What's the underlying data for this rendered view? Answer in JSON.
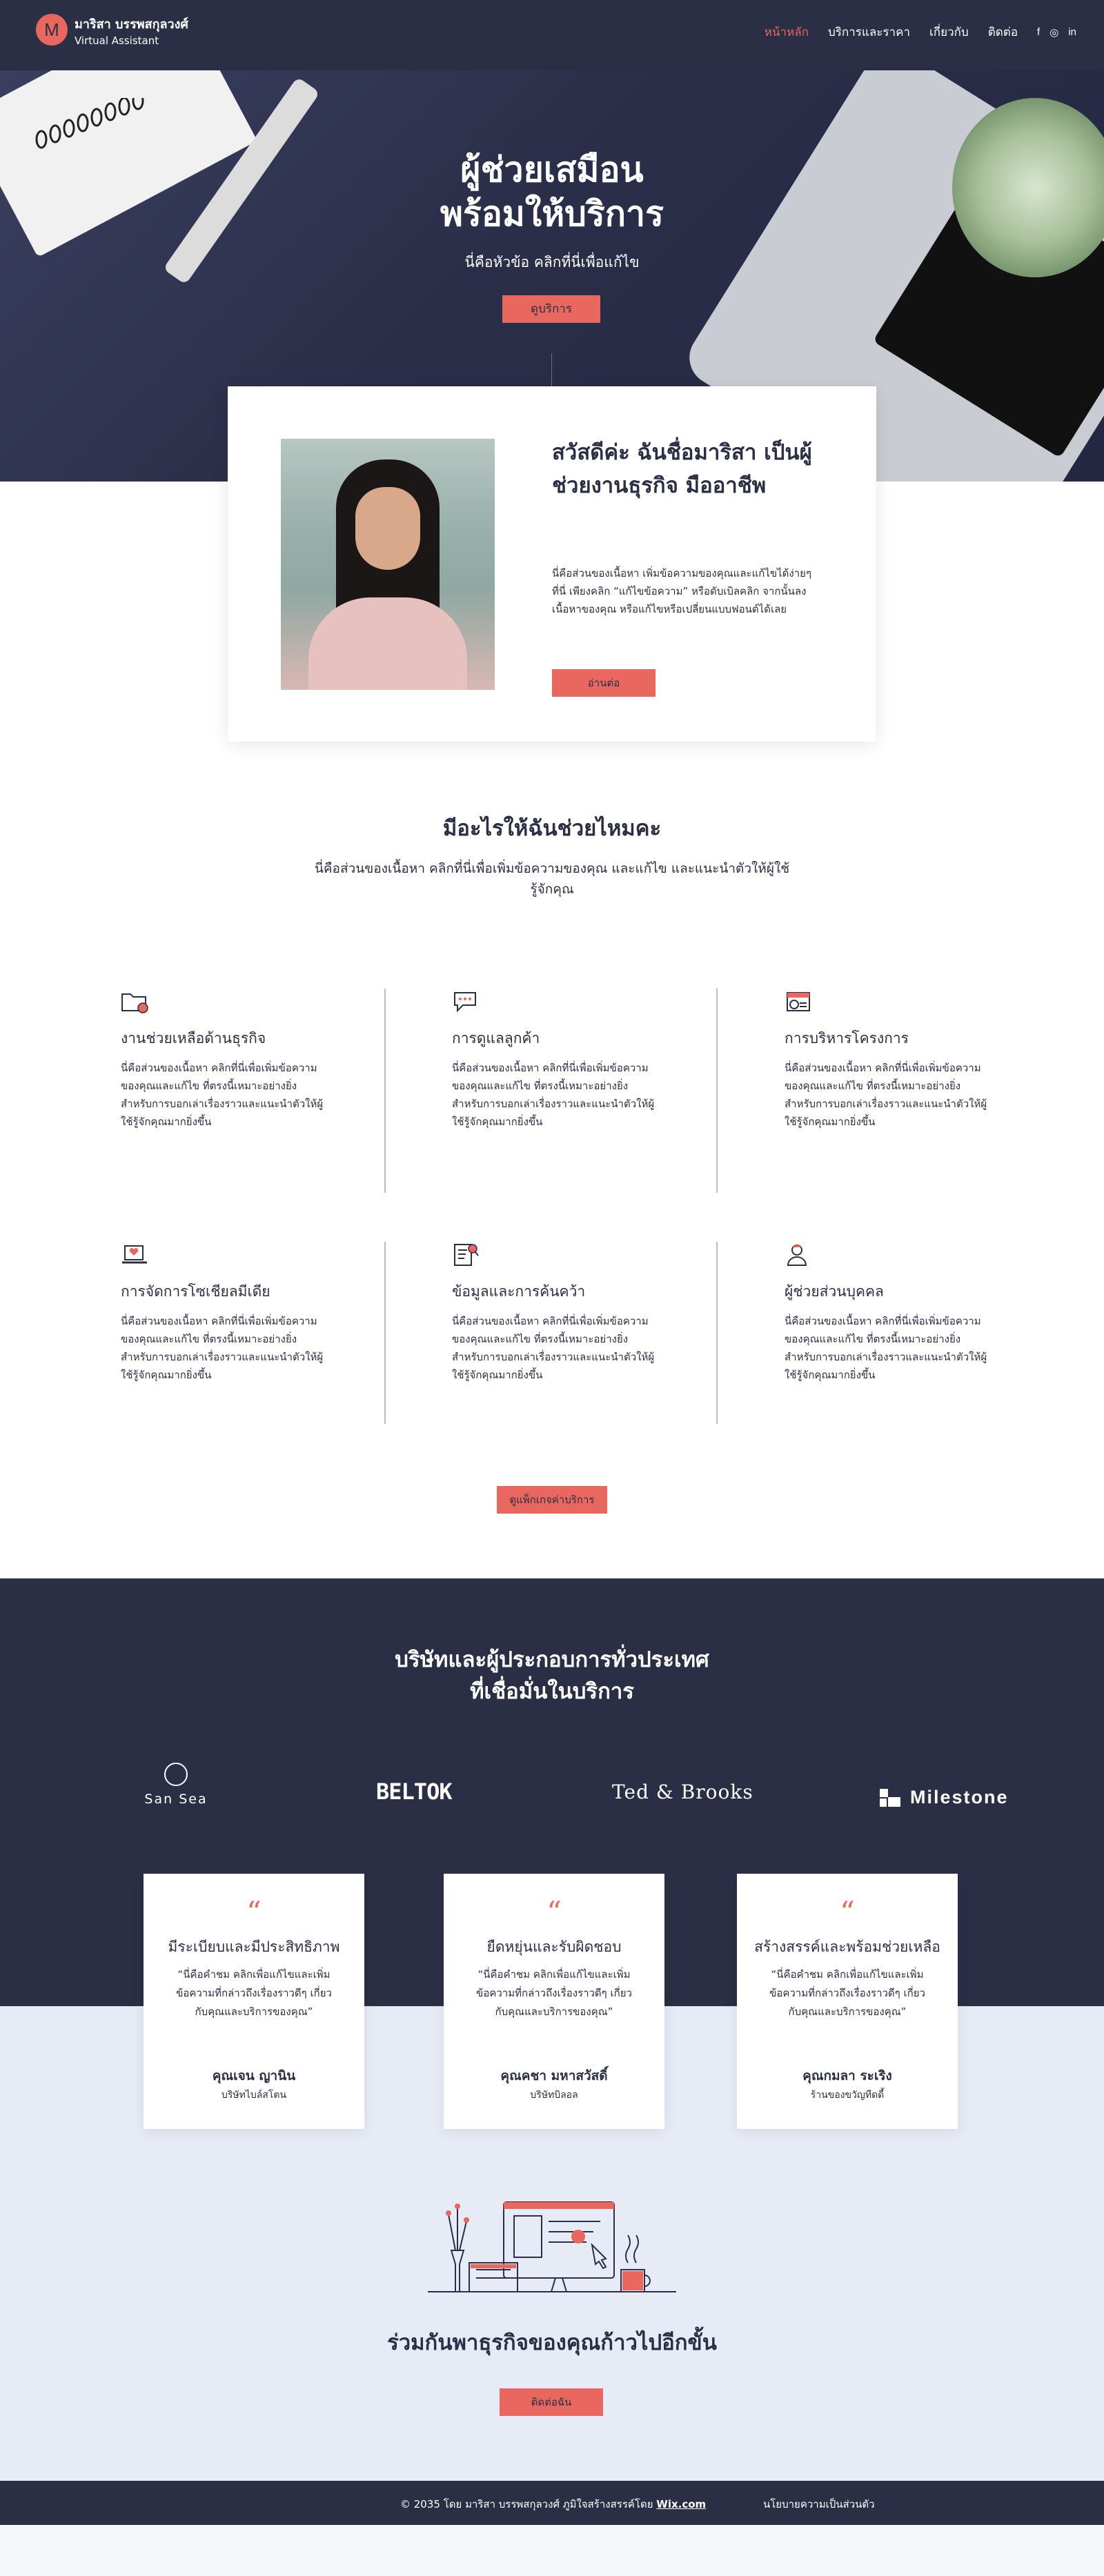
{
  "brand": {
    "initial": "M",
    "name": "มาริสา บรรพสกุลวงศ์",
    "tagline": "Virtual Assistant"
  },
  "nav": {
    "items": [
      "หน้าหลัก",
      "บริการและราคา",
      "เกี่ยวกับ",
      "ติดต่อ"
    ],
    "active_index": 0,
    "social": [
      "f",
      "◎",
      "in"
    ]
  },
  "hero": {
    "title_line1": "ผู้ช่วยเสมือน",
    "title_line2": "พร้อมให้บริการ",
    "subtitle": "นี่คือหัวข้อ คลิกที่นี่เพื่อแก้ไข",
    "button": "ดูบริการ"
  },
  "about": {
    "title": "สวัสดีค่ะ ฉันชื่อมาริสา เป็นผู้ช่วยงานธุรกิจ มืออาชีพ",
    "text": "นี่คือส่วนของเนื้อหา เพิ่มข้อความของคุณและแก้ไขได้ง่ายๆ ที่นี่ เพียงคลิก “แก้ไขข้อความ” หรือดับเบิลคลิก จากนั้นลงเนื้อหาของคุณ หรือแก้ไขหรือเปลี่ยนแบบฟอนต์ได้เลย",
    "button": "อ่านต่อ"
  },
  "services_section": {
    "title": "มีอะไรให้ฉันช่วยไหมคะ",
    "subtitle": "นี่คือส่วนของเนื้อหา คลิกที่นี่เพื่อเพิ่มข้อความของคุณ และแก้ไข และแนะนำตัวให้ผู้ใช้รู้จักคุณ",
    "button": "ดูแพ็กเกจค่าบริการ",
    "items": [
      {
        "icon": "folder-icon",
        "title": "งานช่วยเหลือด้านธุรกิจ",
        "text": "นี่คือส่วนของเนื้อหา คลิกที่นี่เพื่อเพิ่มข้อความของคุณและแก้ไข ที่ตรงนี้เหมาะอย่างยิ่งสำหรับการบอกเล่าเรื่องราวและแนะนำตัวให้ผู้ใช้รู้จักคุณมากยิ่งขึ้น"
      },
      {
        "icon": "chat-bubble-icon",
        "title": "การดูแลลูกค้า",
        "text": "นี่คือส่วนของเนื้อหา คลิกที่นี่เพื่อเพิ่มข้อความของคุณและแก้ไข ที่ตรงนี้เหมาะอย่างยิ่งสำหรับการบอกเล่าเรื่องราวและแนะนำตัวให้ผู้ใช้รู้จักคุณมากยิ่งขึ้น"
      },
      {
        "icon": "calendar-clock-icon",
        "title": "การบริหารโครงการ",
        "text": "นี่คือส่วนของเนื้อหา คลิกที่นี่เพื่อเพิ่มข้อความของคุณและแก้ไข ที่ตรงนี้เหมาะอย่างยิ่งสำหรับการบอกเล่าเรื่องราวและแนะนำตัวให้ผู้ใช้รู้จักคุณมากยิ่งขึ้น"
      },
      {
        "icon": "laptop-heart-icon",
        "title": "การจัดการโซเชียลมีเดีย",
        "text": "นี่คือส่วนของเนื้อหา คลิกที่นี่เพื่อเพิ่มข้อความของคุณและแก้ไข ที่ตรงนี้เหมาะอย่างยิ่งสำหรับการบอกเล่าเรื่องราวและแนะนำตัวให้ผู้ใช้รู้จักคุณมากยิ่งขึ้น"
      },
      {
        "icon": "document-search-icon",
        "title": "ข้อมูลและการค้นคว้า",
        "text": "นี่คือส่วนของเนื้อหา คลิกที่นี่เพื่อเพิ่มข้อความของคุณและแก้ไข ที่ตรงนี้เหมาะอย่างยิ่งสำหรับการบอกเล่าเรื่องราวและแนะนำตัวให้ผู้ใช้รู้จักคุณมากยิ่งขึ้น"
      },
      {
        "icon": "person-icon",
        "title": "ผู้ช่วยส่วนบุคคล",
        "text": "นี่คือส่วนของเนื้อหา คลิกที่นี่เพื่อเพิ่มข้อความของคุณและแก้ไข ที่ตรงนี้เหมาะอย่างยิ่งสำหรับการบอกเล่าเรื่องราวและแนะนำตัวให้ผู้ใช้รู้จักคุณมากยิ่งขึ้น"
      }
    ]
  },
  "partners": {
    "title_line1": "บริษัทและผู้ประกอบการทั่วประเทศ",
    "title_line2": "ที่เชื่อมั่นในบริการ",
    "logos": [
      "San Sea",
      "BELTOK",
      "Ted & Brooks",
      "Milestone"
    ]
  },
  "testimonials": [
    {
      "title": "มีระเบียบและมีประสิทธิภาพ",
      "text": "“นี่คือคำชม คลิกเพื่อแก้ไขและเพิ่มข้อความที่กล่าวถึงเรื่องราวดีๆ เกี่ยวกับคุณและบริการของคุณ”",
      "name": "คุณเจน ญานิน",
      "company": "บริษัทไบล์สโตน"
    },
    {
      "title": "ยืดหยุ่นและรับผิดชอบ",
      "text": "“นี่คือคำชม คลิกเพื่อแก้ไขและเพิ่มข้อความที่กล่าวถึงเรื่องราวดีๆ เกี่ยวกับคุณและบริการของคุณ”",
      "name": "คุณคชา มหาสวัสดิ์",
      "company": "บริษัทบิลอล"
    },
    {
      "title": "สร้างสรรค์และพร้อมช่วยเหลือ",
      "text": "“นี่คือคำชม คลิกเพื่อแก้ไขและเพิ่มข้อความที่กล่าวถึงเรื่องราวดีๆ เกี่ยวกับคุณและบริการของคุณ”",
      "name": "คุณกมลา ระเริง",
      "company": "ร้านของขวัญทีดดี้"
    }
  ],
  "cta": {
    "title": "ร่วมกันพาธุรกิจของคุณก้าวไปอีกขั้น",
    "button": "ติดต่อฉัน"
  },
  "footer": {
    "copyright": "© 2035 โดย มาริสา บรรพสกุลวงศ์ ภูมิใจสร้างสรรค์โดย",
    "link": "Wix.com",
    "privacy": "นโยบายความเป็นส่วนตัว"
  },
  "colors": {
    "navy": "#2a2f45",
    "coral": "#e8675f",
    "lavender": "#e7ebf6"
  }
}
